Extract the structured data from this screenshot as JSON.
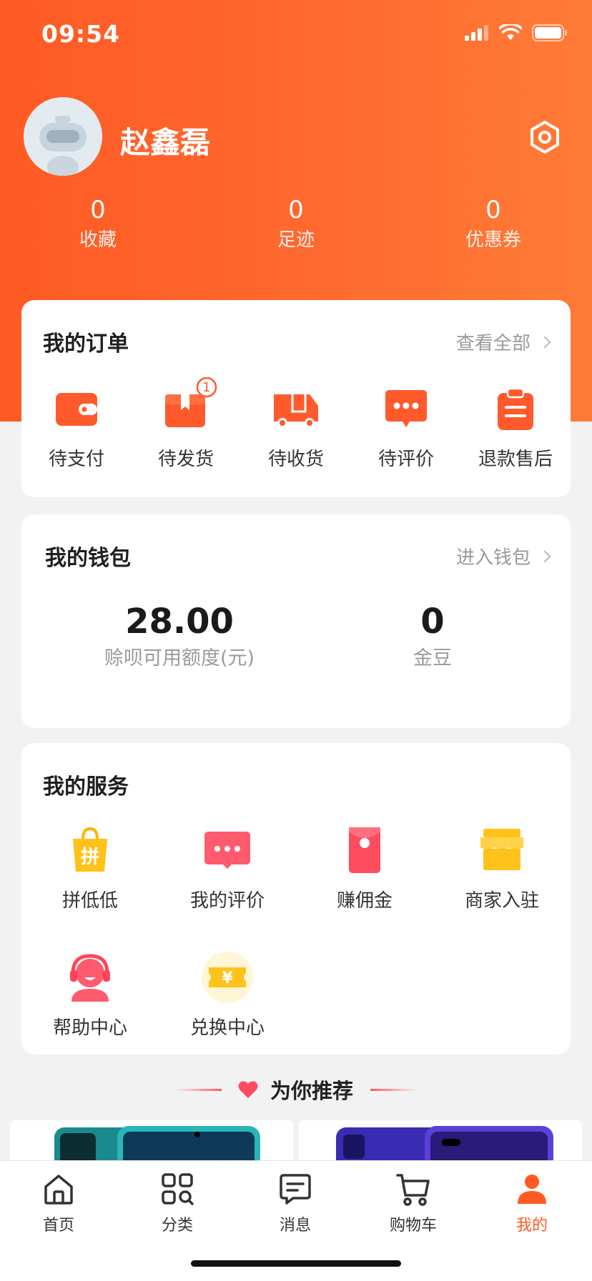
{
  "status_bar": {
    "time": "09:54"
  },
  "profile": {
    "username": "赵鑫磊"
  },
  "stats": [
    {
      "num": "0",
      "label": "收藏"
    },
    {
      "num": "0",
      "label": "足迹"
    },
    {
      "num": "0",
      "label": "优惠券"
    }
  ],
  "orders": {
    "title": "我的订单",
    "view_all": "查看全部",
    "items": [
      {
        "label": "待支付",
        "icon": "wallet-icon"
      },
      {
        "label": "待发货",
        "icon": "box-icon",
        "badge": "1"
      },
      {
        "label": "待收货",
        "icon": "truck-icon"
      },
      {
        "label": "待评价",
        "icon": "comment-icon"
      },
      {
        "label": "退款售后",
        "icon": "clipboard-icon"
      }
    ]
  },
  "wallet": {
    "title": "我的钱包",
    "link": "进入钱包",
    "credit": {
      "value": "28.00",
      "label": "赊呗可用额度(元)"
    },
    "beans": {
      "value": "0",
      "label": "金豆"
    }
  },
  "services": {
    "title": "我的服务",
    "items": [
      {
        "label": "拼低低",
        "icon": "shopping-bag-icon",
        "glyph": "拼"
      },
      {
        "label": "我的评价",
        "icon": "comment-icon"
      },
      {
        "label": "赚佣金",
        "icon": "red-envelope-icon"
      },
      {
        "label": "商家入驻",
        "icon": "store-icon"
      },
      {
        "label": "帮助中心",
        "icon": "headset-icon"
      },
      {
        "label": "兑换中心",
        "icon": "ticket-icon",
        "glyph": "¥"
      }
    ]
  },
  "recommend": {
    "title": "为你推荐"
  },
  "tabbar": [
    {
      "label": "首页",
      "icon": "home-icon"
    },
    {
      "label": "分类",
      "icon": "category-icon"
    },
    {
      "label": "消息",
      "icon": "message-icon"
    },
    {
      "label": "购物车",
      "icon": "cart-icon"
    },
    {
      "label": "我的",
      "icon": "user-icon",
      "active": true
    }
  ],
  "colors": {
    "accent": "#ff5a24",
    "yellow": "#ffc21a",
    "pink": "#ff5264"
  }
}
